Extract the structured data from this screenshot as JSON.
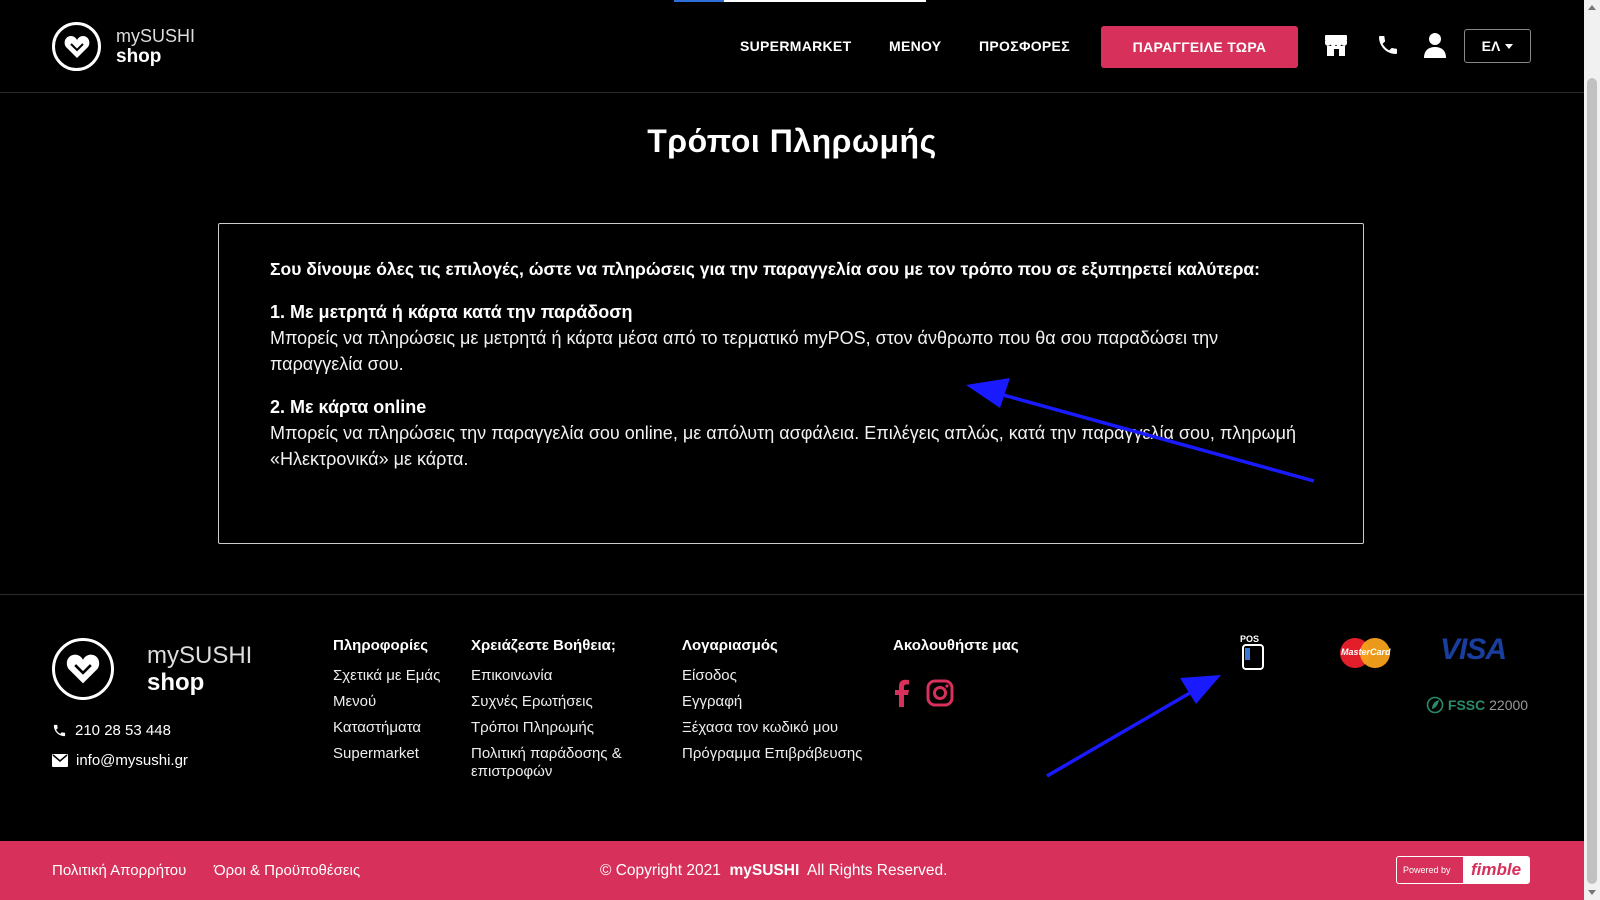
{
  "header": {
    "logo": {
      "line1": "mySUSHI",
      "line2": "shop"
    },
    "nav": [
      {
        "label": "SUPERMARKET"
      },
      {
        "label": "ΜΕΝΟΥ"
      },
      {
        "label": "ΠΡΟΣΦΟΡΕΣ"
      }
    ],
    "order_button": "ΠΑΡΑΓΓΕΙΛΕ ΤΩΡΑ",
    "icons": [
      "store-icon",
      "phone-icon",
      "user-icon"
    ],
    "language": "ΕΛ"
  },
  "page": {
    "title": "Τρόποι Πληρωμής",
    "intro": "Σου δίνουμε όλες τις επιλογές, ώστε να πληρώσεις για την παραγγελία σου με τον τρόπο που σε εξυπηρετεί καλύτερα:",
    "sections": [
      {
        "heading": "1. Με μετρητά ή κάρτα κατά την παράδοση",
        "text": "Μπορείς να πληρώσεις με μετρητά ή κάρτα μέσα από το τερματικό myPOS, στον άνθρωπο που θα σου παραδώσει την παραγγελία σου."
      },
      {
        "heading": "2. Με κάρτα online",
        "text": "Μπορείς να πληρώσεις την παραγγελία σου online, με απόλυτη ασφάλεια. Επιλέγεις απλώς, κατά την παραγγελία σου, πληρωμή «Ηλεκτρονικά» με κάρτα."
      }
    ]
  },
  "footer": {
    "logo": {
      "line1": "mySUSHI",
      "line2": "shop"
    },
    "phone": "210 28 53 448",
    "email": "info@mysushi.gr",
    "columns": [
      {
        "title": "Πληροφορίες",
        "links": [
          "Σχετικά με Εμάς",
          "Μενού",
          "Καταστήματα",
          "Supermarket"
        ]
      },
      {
        "title": "Χρειάζεστε Βοήθεια;",
        "links": [
          "Επικοινωνία",
          "Συχνές Ερωτήσεις",
          "Τρόποι Πληρωμής",
          "Πολιτική παράδοσης & επιστροφών"
        ]
      },
      {
        "title": "Λογαριασμός",
        "links": [
          "Είσοδος",
          "Εγγραφή",
          "Ξέχασα τον κωδικό μου",
          "Πρόγραμμα Επιβράβευσης"
        ]
      },
      {
        "title": "Ακολουθήστε μας",
        "links": []
      }
    ],
    "payment": {
      "pos_label": "POS",
      "mastercard": "MasterCard",
      "visa": "VISA",
      "fssc_a": "FSSC",
      "fssc_b": "22000"
    }
  },
  "bottom_bar": {
    "privacy": "Πολιτική Απορρήτου",
    "terms": "Όροι & Προϋποθέσεις",
    "copyright_pre": "© Copyright 2021",
    "copyright_brand": "mySUSHI",
    "copyright_post": "All Rights Reserved.",
    "powered_by": "Powered by",
    "powered_brand": "fimble"
  },
  "colors": {
    "accent": "#d6305b",
    "background": "#000000",
    "annotation": "#1a1aff"
  }
}
